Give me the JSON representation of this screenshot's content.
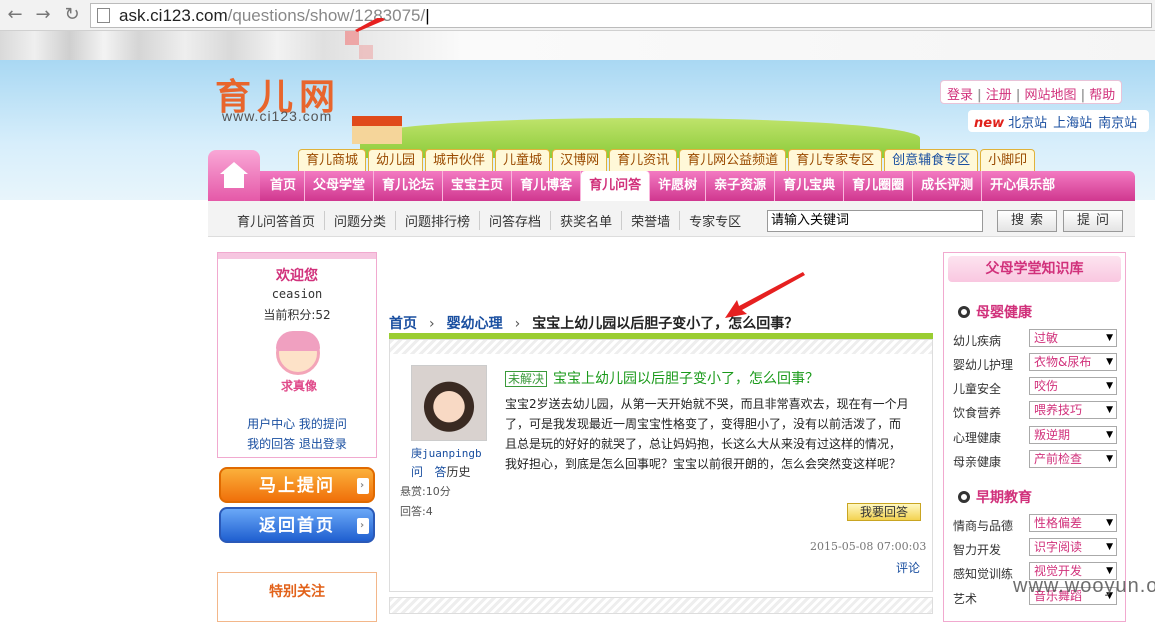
{
  "browser": {
    "back": "←",
    "forward": "→",
    "reload": "↻",
    "url_host": "ask.ci123.com",
    "url_path": "/questions/show/1283075/"
  },
  "site": {
    "logo": "育儿网",
    "logo_url": "www.ci123.com",
    "toplinks": [
      "登录",
      "注册",
      "网站地图",
      "帮助"
    ],
    "new_badge": "new",
    "cities": [
      "北京站",
      "上海站",
      "南京站"
    ]
  },
  "tabs": [
    "育儿商城",
    "幼儿园",
    "城市伙伴",
    "儿童城",
    "汉博网",
    "育儿资讯",
    "育儿网公益频道",
    "育儿专家专区",
    "创意辅食专区",
    "小脚印"
  ],
  "pinknav": [
    "首页",
    "父母学堂",
    "育儿论坛",
    "宝宝主页",
    "育儿博客",
    "育儿问答",
    "许愿树",
    "亲子资源",
    "育儿宝典",
    "育儿圈圈",
    "成长评测",
    "开心俱乐部"
  ],
  "subnav": {
    "items": [
      "育儿问答首页",
      "问题分类",
      "问题排行榜",
      "问答存档",
      "获奖名单",
      "荣誉墙",
      "专家专区"
    ],
    "search_value": "请输入关键词",
    "search_btn": "搜索",
    "ask_btn": "提问"
  },
  "welcome": {
    "title": "欢迎您",
    "user": "ceasion",
    "points": "当前积分:52",
    "avatar_label": "求真像",
    "links1": "用户中心  我的提问",
    "links2": "我的回答  退出登录"
  },
  "buttons": {
    "ask": "马上提问",
    "home": "返回首页",
    "arrow": "›"
  },
  "special": "特别关注",
  "breadcrumb": {
    "home": "首页",
    "cat": "婴幼心理",
    "sep": "›",
    "title": "宝宝上幼儿园以后胆子变小了，怎么回事？"
  },
  "question": {
    "badge": "未解决",
    "title": "宝宝上幼儿园以后胆子变小了，怎么回事？",
    "body": "宝宝2岁送去幼儿园，从第一天开始就不哭，而且非常喜欢去，现在有一个月了，可是我发现最近一周宝宝性格变了，变得胆小了，没有以前活泼了，而且总是玩的好好的就哭了，总让妈妈抱，长这么大从来没有过这样的情况，我好担心，到底是怎么回事呢？宝宝以前很开朗的，怎么会突然变这样呢？",
    "asker": "庚juanpingb",
    "ask_link": "问",
    "answer_link": "答",
    "history": "历史",
    "reward": "悬赏:10分",
    "answers": "回答:4",
    "answer_btn": "我要回答",
    "date": "2015-05-08 07:00:03",
    "comment": "评论"
  },
  "knowledge": {
    "title": "父母学堂知识库",
    "sections": [
      {
        "title": "母婴健康",
        "rows": [
          {
            "label": "幼儿疾病",
            "value": "过敏"
          },
          {
            "label": "婴幼儿护理",
            "value": "衣物&尿布"
          },
          {
            "label": "儿童安全",
            "value": "咬伤"
          },
          {
            "label": "饮食营养",
            "value": "喂养技巧"
          },
          {
            "label": "心理健康",
            "value": "叛逆期"
          },
          {
            "label": "母亲健康",
            "value": "产前检查"
          }
        ]
      },
      {
        "title": "早期教育",
        "rows": [
          {
            "label": "情商与品德",
            "value": "性格偏差"
          },
          {
            "label": "智力开发",
            "value": "识字阅读"
          },
          {
            "label": "感知觉训练",
            "value": "视觉开发"
          },
          {
            "label": "艺术",
            "value": "音乐舞蹈"
          }
        ]
      }
    ],
    "dropdown": "▼"
  },
  "watermark": "www.wooyun.org"
}
